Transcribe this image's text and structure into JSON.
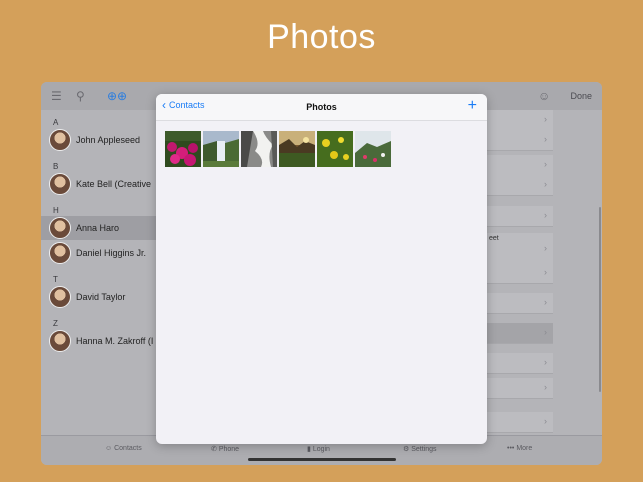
{
  "headline": "Photos",
  "background_app": {
    "done_label": "Done",
    "sections": [
      {
        "letter": "A",
        "contacts": [
          "John Appleseed"
        ]
      },
      {
        "letter": "B",
        "contacts": [
          "Kate Bell (Creative"
        ]
      },
      {
        "letter": "H",
        "contacts": [
          "Anna Haro",
          "Daniel Higgins Jr."
        ]
      },
      {
        "letter": "T",
        "contacts": [
          "David Taylor"
        ]
      },
      {
        "letter": "Z",
        "contacts": [
          "Hanna M. Zakroff (I"
        ]
      }
    ],
    "right_fragment_text": "eet",
    "tabs": [
      "Contacts",
      "Phone",
      "Login",
      "Settings",
      "More"
    ]
  },
  "modal": {
    "back_label": "Contacts",
    "title": "Photos",
    "add_glyph": "+",
    "photos": [
      "pink-flowers",
      "waterfall",
      "cascade",
      "canyon-sunset",
      "yellow-flowers",
      "coastal-hill"
    ]
  }
}
